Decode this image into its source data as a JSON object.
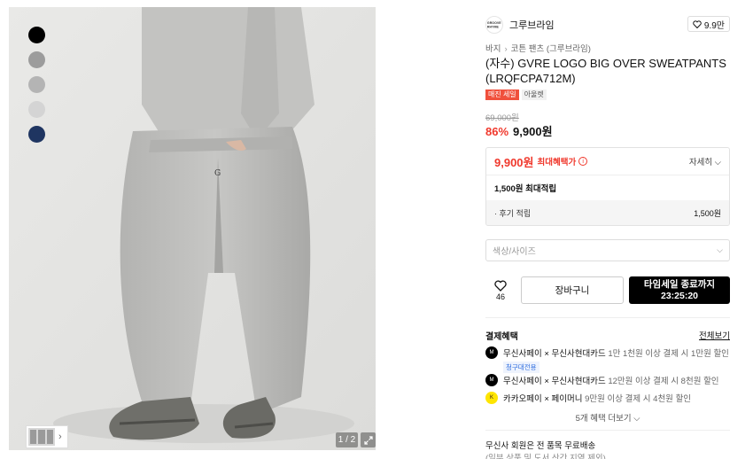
{
  "colors": {
    "accent_red": "#f0382c",
    "sale_tag": "#f0503c",
    "buy_button": "#000000",
    "kakao_yellow": "#fee500",
    "swatches": [
      "#000000",
      "#9c9c9c",
      "#b4b4b4",
      "#d4d4d4",
      "#1f3561"
    ]
  },
  "gallery": {
    "counter": "1 / 2"
  },
  "brand": {
    "logo_text": "GROOVE RHYME",
    "name": "그루브라임",
    "likes": "9.9만"
  },
  "breadcrumb": [
    "바지",
    "코튼 팬츠 (그루브라임)"
  ],
  "product": {
    "title": "(자수) GVRE LOGO BIG OVER SWEATPANTS (LRQFCPA712M)",
    "tags": [
      "매진 세일",
      "아울렛"
    ],
    "original_price": "69,000원",
    "discount": "86%",
    "price": "9,900원"
  },
  "benefit": {
    "price": "9,900원",
    "max_label": "최대혜택가",
    "detail_label": "자세히",
    "points_line": "1,500원 최대적립",
    "review_label": "· 후기 적립",
    "review_value": "1,500원"
  },
  "option_select": {
    "placeholder": "색상/사이즈"
  },
  "actions": {
    "wish_count": "46",
    "cart_label": "장바구니",
    "buy_line1": "타임세일 종료까지",
    "buy_line2": "23:25:20"
  },
  "payment": {
    "title": "결제혜택",
    "view_all": "전체보기",
    "items": [
      {
        "icon": "musinsa-pay-icon",
        "main": "무신사페이 × 무신사현대카드",
        "desc": "1만 1천원 이상 결제 시 1만원 할인",
        "tag": "청구대전용"
      },
      {
        "icon": "musinsa-pay-icon",
        "main": "무신사페이 × 무신사현대카드",
        "desc": "12만원 이상 결제 시 8천원 할인",
        "tag": ""
      },
      {
        "icon": "kakao-pay-icon",
        "main": "카카오페이 × 페이머니",
        "desc": "9만원 이상 결제 시 4천원 할인",
        "tag": ""
      }
    ],
    "more": "5개 혜택 더보기"
  },
  "shipping": {
    "line1": "무신사 회원은 전 품목 무료배송",
    "line2": "(일부 상품 및 도서 산간 지역 제외)"
  }
}
